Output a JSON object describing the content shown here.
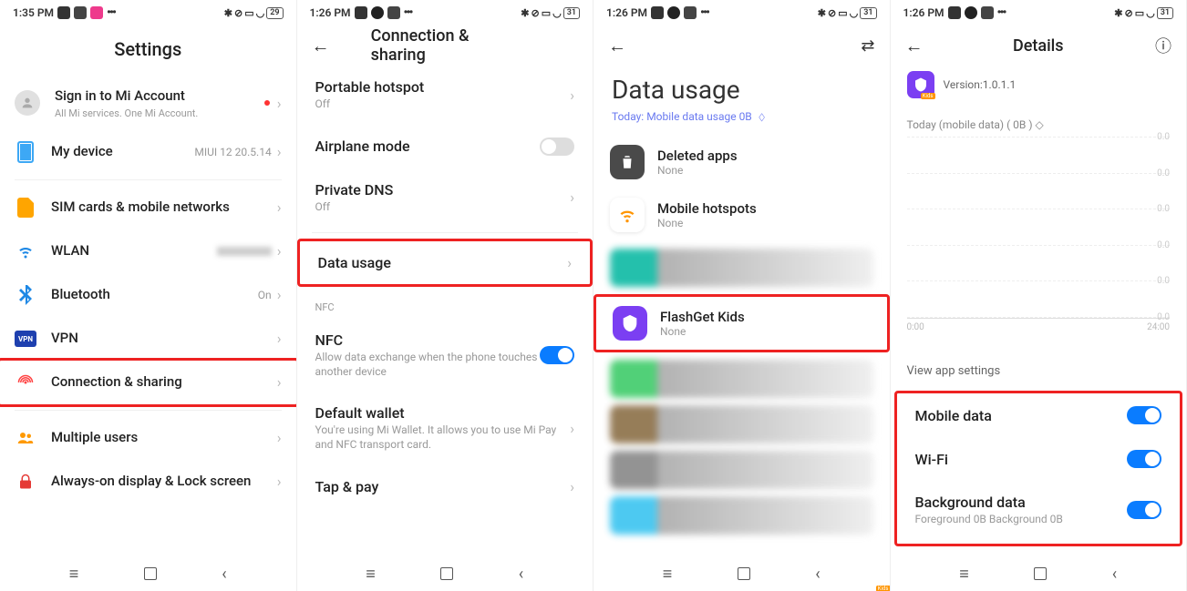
{
  "status": {
    "time_s1": "1:35 PM",
    "time_other": "1:26 PM",
    "battery_s1": "29",
    "battery_other": "31",
    "more": "•••"
  },
  "s1": {
    "title": "Settings",
    "signin_title": "Sign in to Mi Account",
    "signin_sub": "All Mi services. One Mi Account.",
    "mydevice": "My device",
    "mydevice_right": "MIUI 12 20.5.14",
    "sim": "SIM cards & mobile networks",
    "wlan": "WLAN",
    "bluetooth": "Bluetooth",
    "bluetooth_right": "On",
    "vpn": "VPN",
    "vpn_label": "VPN",
    "conn": "Connection & sharing",
    "multi": "Multiple users",
    "aod": "Always-on display & Lock screen"
  },
  "s2": {
    "title": "Connection & sharing",
    "hotspot": "Portable hotspot",
    "hotspot_sub": "Off",
    "airplane": "Airplane mode",
    "dns": "Private DNS",
    "dns_sub": "Off",
    "datausage": "Data usage",
    "nfc_section": "NFC",
    "nfc": "NFC",
    "nfc_sub": "Allow data exchange when the phone touches another device",
    "wallet": "Default wallet",
    "wallet_sub": "You're using Mi Wallet. It allows you to use Mi Pay and NFC transport card.",
    "tap": "Tap & pay"
  },
  "s3": {
    "title": "Data usage",
    "filter": "Today: Mobile data usage 0B",
    "deleted": "Deleted apps",
    "none": "None",
    "hotspots": "Mobile hotspots",
    "fgk": "FlashGet Kids"
  },
  "s4": {
    "title": "Details",
    "version": "Version:1.0.1.1",
    "kids": "Kids",
    "filter": "Today (mobile data) ( 0B )",
    "viewlink": "View app settings",
    "mobile": "Mobile data",
    "wifi": "Wi-Fi",
    "bg": "Background data",
    "bg_sub": "Foreground 0B  Background 0B"
  },
  "nav": {
    "menu": "≡",
    "back": "‹"
  },
  "chart_data": {
    "type": "line",
    "title": "Today (mobile data) ( 0B )",
    "xlabel": "",
    "ylabel": "",
    "x_ticks": [
      "0:00",
      "24:00"
    ],
    "y_ticks": [
      "0.0",
      "0.0",
      "0.0",
      "0.0",
      "0.0",
      "0.0"
    ],
    "ylim": [
      0,
      0
    ],
    "series": [
      {
        "name": "mobile data",
        "values": []
      }
    ]
  }
}
